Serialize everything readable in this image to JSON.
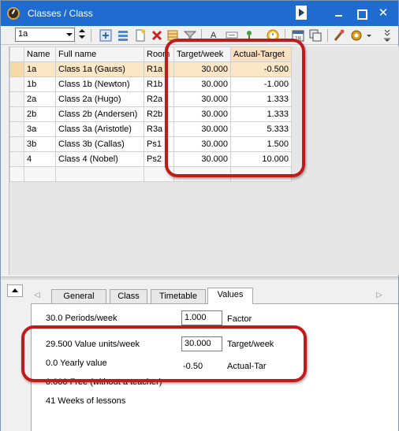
{
  "window": {
    "title": "Classes / Class",
    "close_glyph": "✕"
  },
  "toolbar": {
    "class_select_value": "1a",
    "icons": [
      "new-record-icon",
      "list-view-icon",
      "new-document-icon",
      "delete-icon",
      "spreadsheet-icon",
      "filter-icon",
      "font-color-icon",
      "reset-format-icon",
      "tree-icon",
      "clock-icon",
      "calendar-icon",
      "copy-icon",
      "brush-icon",
      "settings-icon",
      "more-icon"
    ],
    "calendar_day": "18"
  },
  "grid": {
    "columns": [
      "Name",
      "Full name",
      "Room",
      "Target/week",
      "Actual-Target"
    ],
    "rows": [
      {
        "name": "1a",
        "full_name": "Class 1a (Gauss)",
        "room": "R1a",
        "target": "30.000",
        "actual": "-0.500",
        "selected": true
      },
      {
        "name": "1b",
        "full_name": "Class 1b (Newton)",
        "room": "R1b",
        "target": "30.000",
        "actual": "-1.000"
      },
      {
        "name": "2a",
        "full_name": "Class 2a (Hugo)",
        "room": "R2a",
        "target": "30.000",
        "actual": "1.333"
      },
      {
        "name": "2b",
        "full_name": "Class 2b (Andersen)",
        "room": "R2b",
        "target": "30.000",
        "actual": "1.333"
      },
      {
        "name": "3a",
        "full_name": "Class 3a (Aristotle)",
        "room": "R3a",
        "target": "30.000",
        "actual": "5.333"
      },
      {
        "name": "3b",
        "full_name": "Class 3b (Callas)",
        "room": "Ps1",
        "target": "30.000",
        "actual": "1.500"
      },
      {
        "name": "4",
        "full_name": "Class 4 (Nobel)",
        "room": "Ps2",
        "target": "30.000",
        "actual": "10.000"
      }
    ]
  },
  "tabs": [
    "General",
    "Class",
    "Timetable",
    "Values"
  ],
  "active_tab": "Values",
  "values_panel": {
    "periods_label": "30.0 Periods/week",
    "factor_value": "1.000",
    "factor_label": "Factor",
    "value_units_label": "29.500 Value units/week",
    "target_value": "30.000",
    "target_label": "Target/week",
    "yearly_label": "0.0 Yearly value",
    "actual_value": "-0.50",
    "actual_label": "Actual-Tar",
    "free_label": "0.000 Free (without a teacher)",
    "weeks_label": "41 Weeks of lessons"
  },
  "colors": {
    "titlebar": "#1f6bd0",
    "selected_row": "#fbe7c6",
    "highlight": "#c11a1a"
  }
}
